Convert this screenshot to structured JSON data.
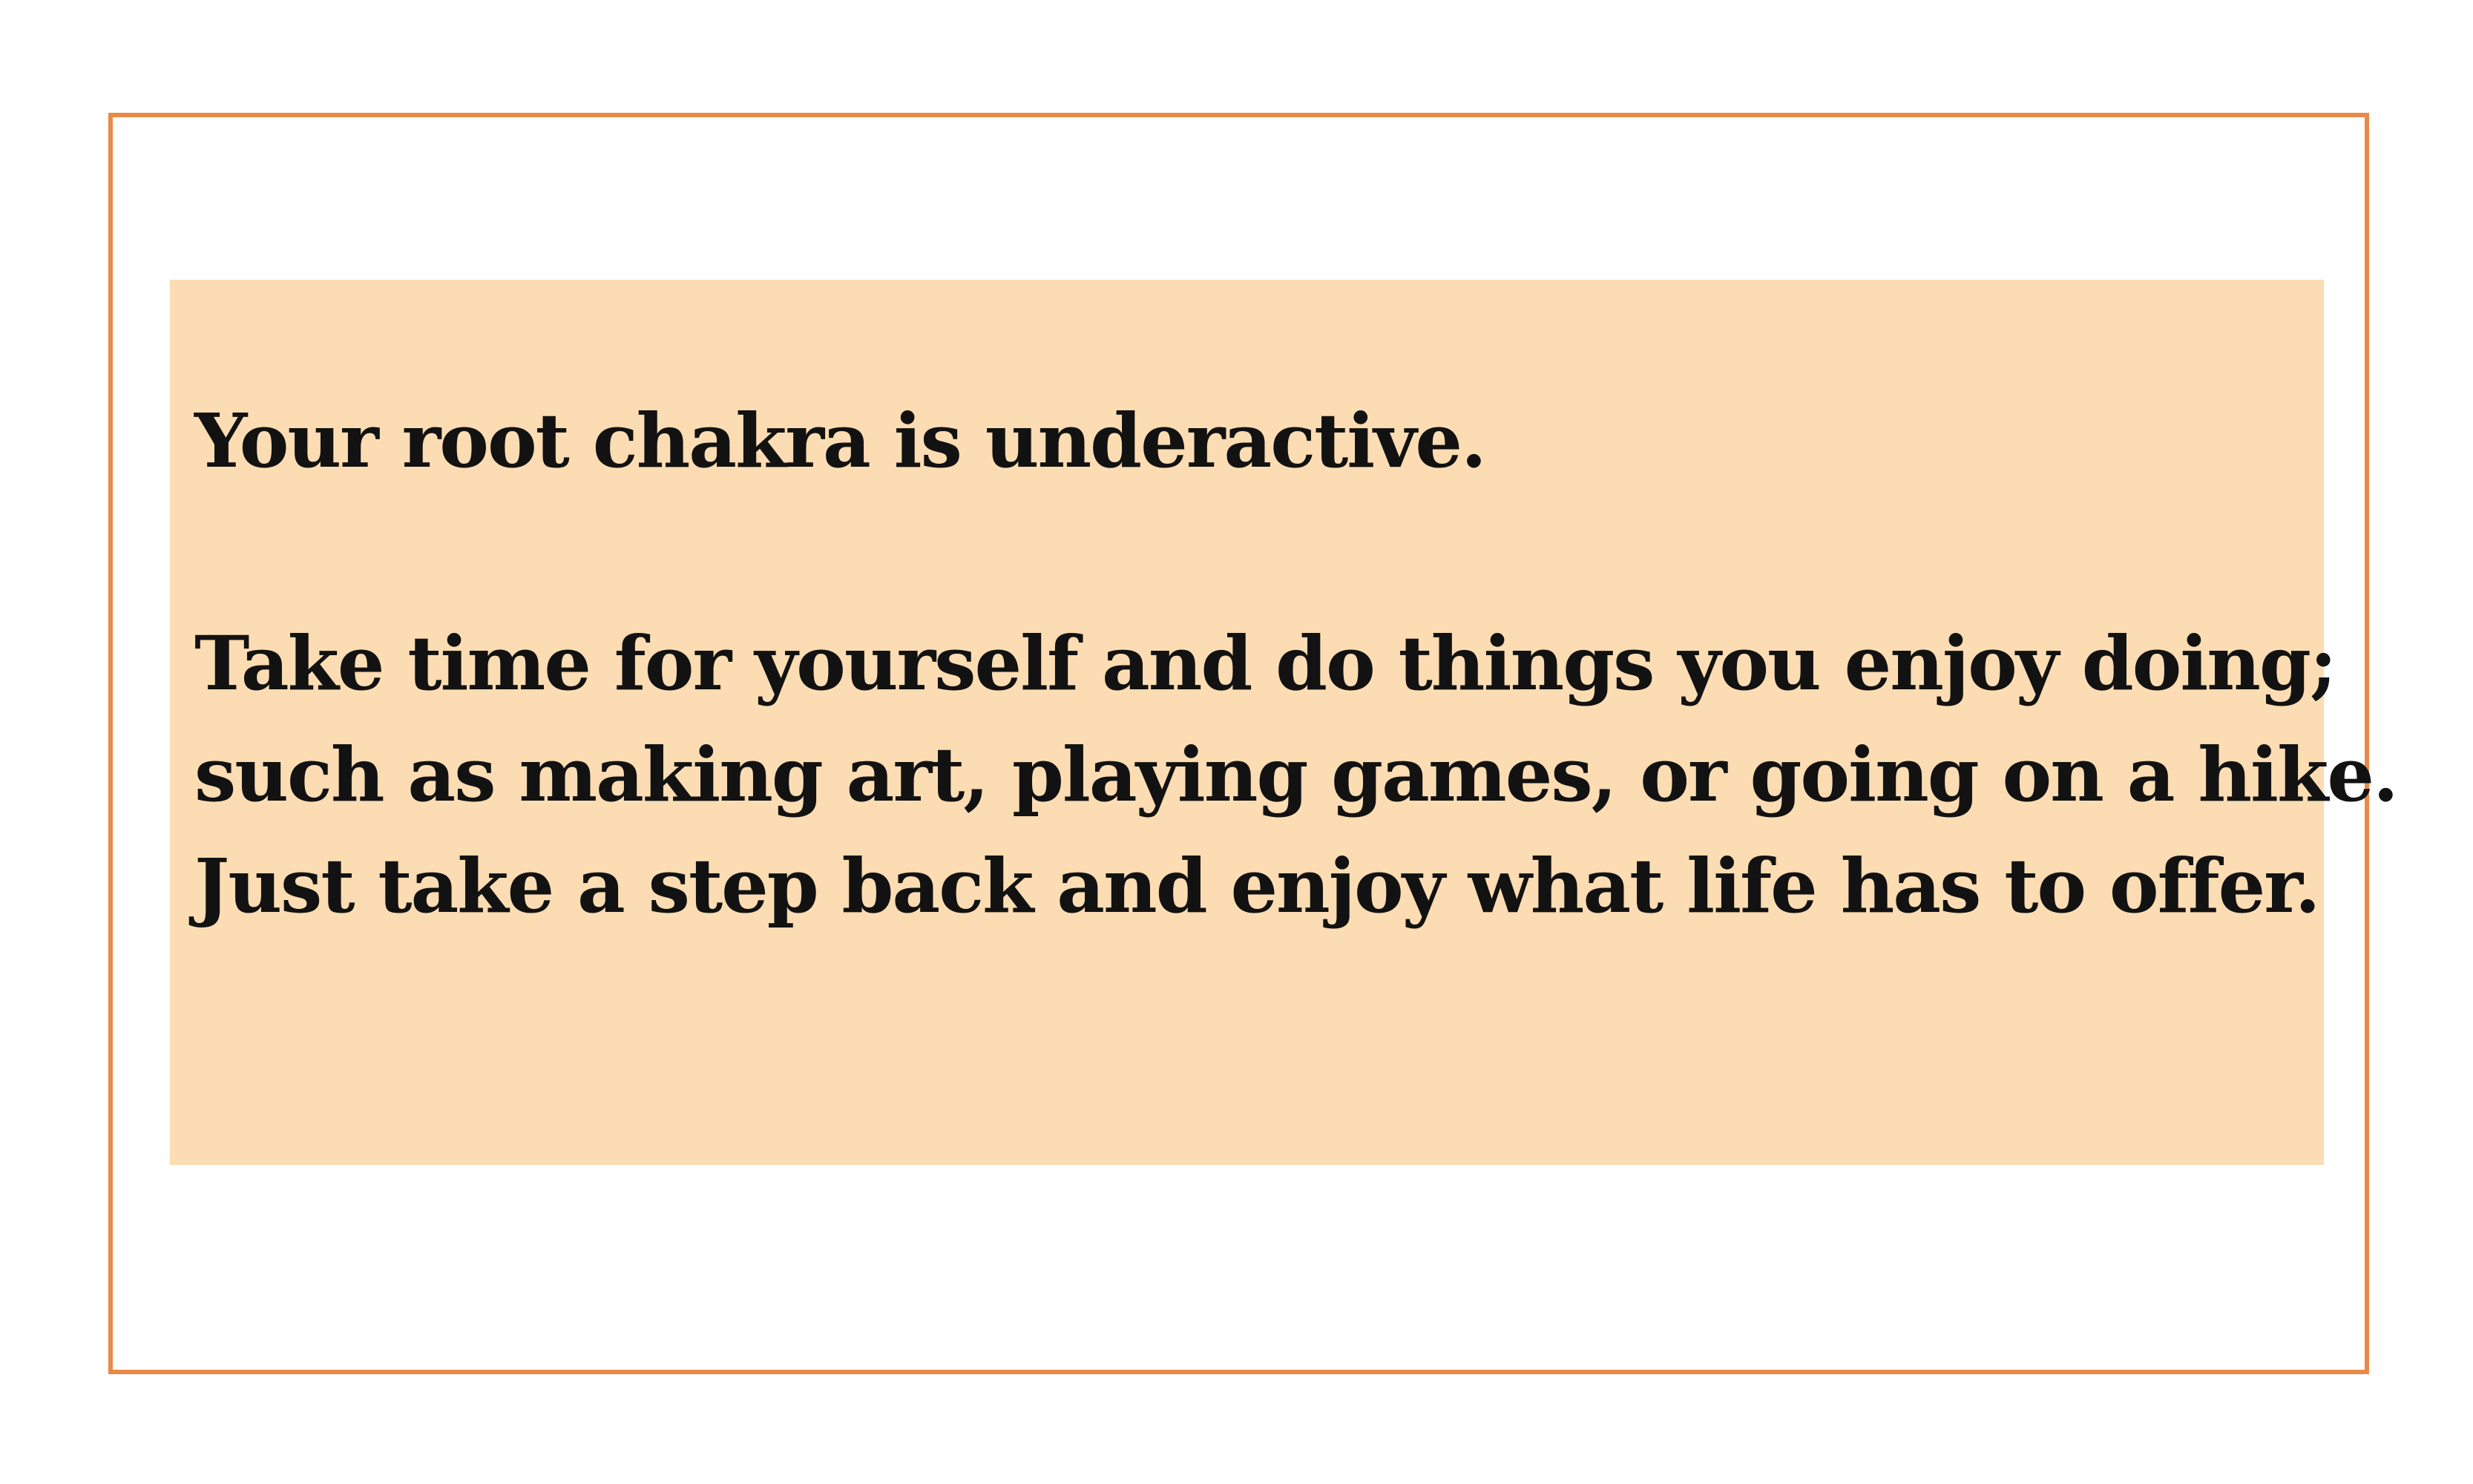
{
  "card": {
    "heading": "Your root chakra is underactive.",
    "body_lines": [
      "Take time for yourself and do things you enjoy doing;",
      "such as making art, playing games, or going on a hike.",
      "Just take a step back and enjoy what life has to offer."
    ]
  },
  "colors": {
    "border": "#E98A47",
    "panel": "#FCDCB2",
    "text": "#121212",
    "background": "#FFFFFF"
  }
}
